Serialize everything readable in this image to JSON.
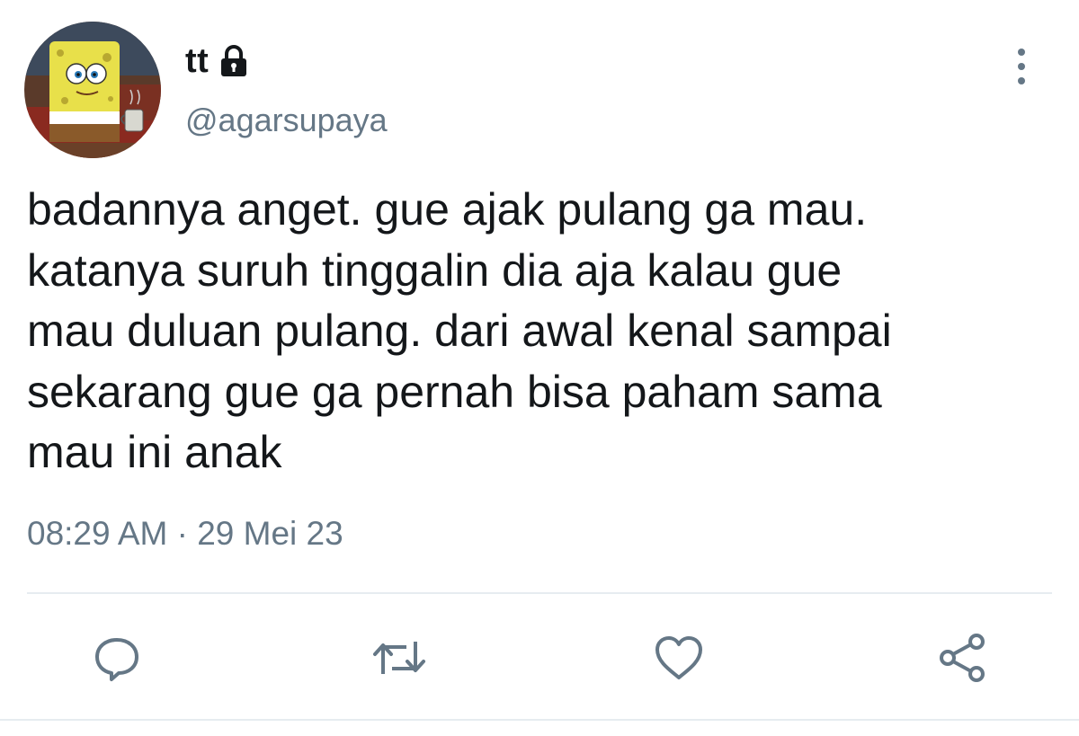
{
  "user": {
    "display_name": "tt",
    "handle": "@agarsupaya",
    "protected": true,
    "avatar": "spongebob-avatar"
  },
  "tweet": {
    "text": "badannya anget. gue ajak pulang ga mau.\nkatanya suruh tinggalin dia aja kalau gue\nmau duluan pulang. dari awal kenal sampai\nsekarang gue ga pernah bisa paham sama\nmau ini anak",
    "timestamp": "08:29 AM · 29 Mei 23"
  },
  "icons": {
    "lock": "lock-icon",
    "more": "more-vertical-icon",
    "reply": "reply-icon",
    "retweet": "retweet-icon",
    "like": "heart-icon",
    "share": "share-icon"
  },
  "colors": {
    "text": "#14171a",
    "secondary": "#657786",
    "icon": "#657786",
    "divider": "#e6ecf0"
  }
}
